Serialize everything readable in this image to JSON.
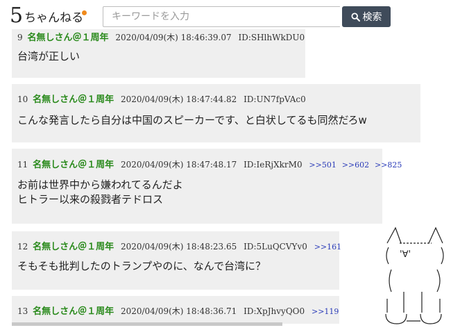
{
  "header": {
    "logo_mark": "5",
    "logo_text": "ちゃんねる",
    "search_placeholder": "キーワードを入力",
    "search_button_label": "検索"
  },
  "posts": [
    {
      "number": "9",
      "name": "名無しさん＠１周年",
      "date": "2020/04/09(木) 18:46:39.07",
      "id": "ID:SHlhWkDU0",
      "anchors": [],
      "lines": [
        "台湾が正しい"
      ]
    },
    {
      "number": "10",
      "name": "名無しさん＠１周年",
      "date": "2020/04/09(木) 18:47:44.82",
      "id": "ID:UN7fpVAc0",
      "anchors": [],
      "lines": [
        "こんな発言したら自分は中国のスピーカーです、と白状してるも同然だろw"
      ]
    },
    {
      "number": "11",
      "name": "名無しさん＠１周年",
      "date": "2020/04/09(木) 18:47:48.17",
      "id": "ID:IeRjXkrM0",
      "anchors": [
        ">>501",
        ">>602",
        ">>825"
      ],
      "lines": [
        "お前は世界中から嫌われてるんだよ",
        "ヒトラー以来の殺戮者テドロス"
      ]
    },
    {
      "number": "12",
      "name": "名無しさん＠１周年",
      "date": "2020/04/09(木) 18:48:23.65",
      "id": "ID:5LuQCVYv0",
      "anchors": [
        ">>161"
      ],
      "lines": [
        "そもそも批判したのトランプやのに、なんで台湾に？"
      ]
    },
    {
      "number": "13",
      "name": "名無しさん＠１周年",
      "date": "2020/04/09(木) 18:48:36.71",
      "id": "ID:XpJhvyQO0",
      "anchors": [
        ">>119"
      ],
      "lines": []
    }
  ],
  "ascii_art_face": "'∀'"
}
